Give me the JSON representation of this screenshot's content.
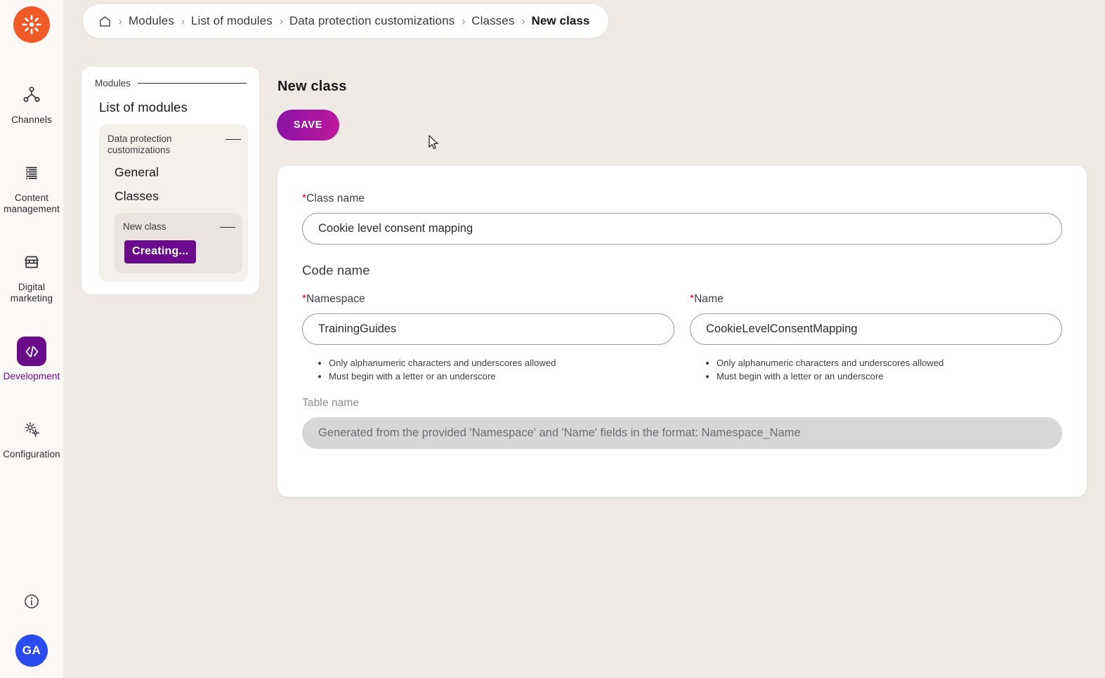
{
  "app": {
    "logo_icon": "kentico-burst-logo",
    "logo_color": "#F05A28"
  },
  "rail": {
    "items": [
      {
        "label": "Channels",
        "icon": "channels-network-icon",
        "active": false
      },
      {
        "label": "Content\nmanagement",
        "icon": "content-list-icon",
        "active": false
      },
      {
        "label": "Digital\nmarketing",
        "icon": "storefront-icon",
        "active": false
      },
      {
        "label": "Development",
        "icon": "code-brackets-icon",
        "active": true
      },
      {
        "label": "Configuration",
        "icon": "gears-icon",
        "active": false
      }
    ],
    "active_color": "#6A0B8C",
    "info_icon": "info-circle-icon",
    "avatar_initials": "GA",
    "avatar_color": "#2A4BEF"
  },
  "breadcrumb": {
    "home_icon": "home-icon",
    "separator": "›",
    "items": [
      {
        "label": "Modules",
        "current": false
      },
      {
        "label": "List of modules",
        "current": false
      },
      {
        "label": "Data protection customizations",
        "current": false
      },
      {
        "label": "Classes",
        "current": false
      },
      {
        "label": "New class",
        "current": true
      }
    ]
  },
  "nav_card": {
    "header_label": "Modules",
    "root_item": "List of modules",
    "group": {
      "label": "Data protection customizations",
      "items": [
        "General",
        "Classes"
      ],
      "inner": {
        "label": "New class",
        "badge": "Creating...",
        "badge_color": "#6A0B8C"
      }
    }
  },
  "main": {
    "page_title": "New class",
    "save_label": "SAVE",
    "save_gradient_from": "#8A13A8",
    "save_gradient_to": "#C2189B",
    "required_marker": "*",
    "required_color": "#D0021B",
    "class_name": {
      "label": "Class name",
      "value": "Cookie level consent mapping",
      "placeholder": ""
    },
    "code_name_heading": "Code name",
    "namespace": {
      "label": "Namespace",
      "value": "TrainingGuides",
      "placeholder": "",
      "hints": [
        "Only alphanumeric characters and underscores allowed",
        "Must begin with a letter or an underscore"
      ]
    },
    "name": {
      "label": "Name",
      "value": "CookieLevelConsentMapping",
      "placeholder": "",
      "hints": [
        "Only alphanumeric characters and underscores allowed",
        "Must begin with a letter or an underscore"
      ]
    },
    "table_name": {
      "label": "Table name",
      "value": "",
      "placeholder": "Generated from the provided 'Namespace' and 'Name' fields in the format: Namespace_Name",
      "disabled": true
    }
  }
}
